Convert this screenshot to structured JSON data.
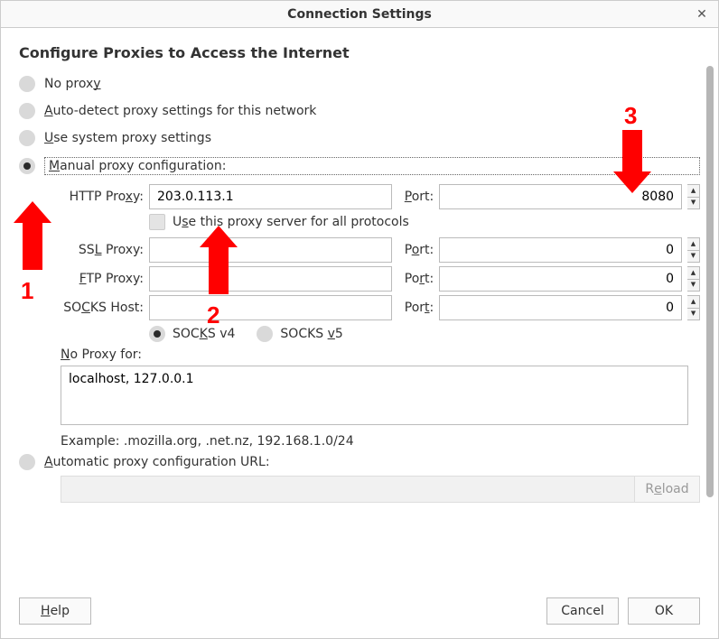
{
  "window": {
    "title": "Connection Settings",
    "close_symbol": "✕"
  },
  "heading": "Configure Proxies to Access the Internet",
  "radios": {
    "no_proxy": {
      "pre": "No prox",
      "u": "y",
      "post": ""
    },
    "auto_detect": {
      "pre": "",
      "u": "A",
      "post": "uto-detect proxy settings for this network"
    },
    "system": {
      "pre": "",
      "u": "U",
      "post": "se system proxy settings"
    },
    "manual": {
      "pre": "",
      "u": "M",
      "post": "anual proxy configuration:"
    },
    "auto_url": {
      "pre": "",
      "u": "A",
      "post": "utomatic proxy configuration URL:"
    }
  },
  "proxy": {
    "http": {
      "label_pre": "HTTP Pro",
      "label_u": "x",
      "label_post": "y:",
      "value": "203.0.113.1",
      "port_label_pre": "",
      "port_label_u": "P",
      "port_label_post": "ort:",
      "port": "8080"
    },
    "use_for_all": {
      "pre": "U",
      "u": "s",
      "post": "e this proxy server for all protocols"
    },
    "ssl": {
      "label_pre": "SS",
      "label_u": "L",
      "label_post": " Proxy:",
      "value": "",
      "port_label_pre": "P",
      "port_label_u": "o",
      "port_label_post": "rt:",
      "port": "0"
    },
    "ftp": {
      "label_pre": "",
      "label_u": "F",
      "label_post": "TP Proxy:",
      "value": "",
      "port_label_pre": "Po",
      "port_label_u": "r",
      "port_label_post": "t:",
      "port": "0"
    },
    "socks": {
      "label_pre": "SO",
      "label_u": "C",
      "label_post": "KS Host:",
      "value": "",
      "port_label_pre": "Por",
      "port_label_u": "t",
      "port_label_post": ":",
      "port": "0"
    },
    "socks_v4": {
      "pre": "SOC",
      "u": "K",
      "post": "S v4"
    },
    "socks_v5": {
      "pre": "SOCKS ",
      "u": "v",
      "post": "5"
    }
  },
  "no_proxy_for": {
    "label_pre": "",
    "label_u": "N",
    "label_post": "o Proxy for:",
    "value": "localhost, 127.0.0.1",
    "example": "Example: .mozilla.org, .net.nz, 192.168.1.0/24"
  },
  "auto_url": {
    "value": "",
    "reload_pre": "R",
    "reload_u": "e",
    "reload_post": "load"
  },
  "buttons": {
    "help_pre": "",
    "help_u": "H",
    "help_post": "elp",
    "cancel": "Cancel",
    "ok": "OK"
  },
  "annotations": {
    "n1": "1",
    "n2": "2",
    "n3": "3"
  }
}
